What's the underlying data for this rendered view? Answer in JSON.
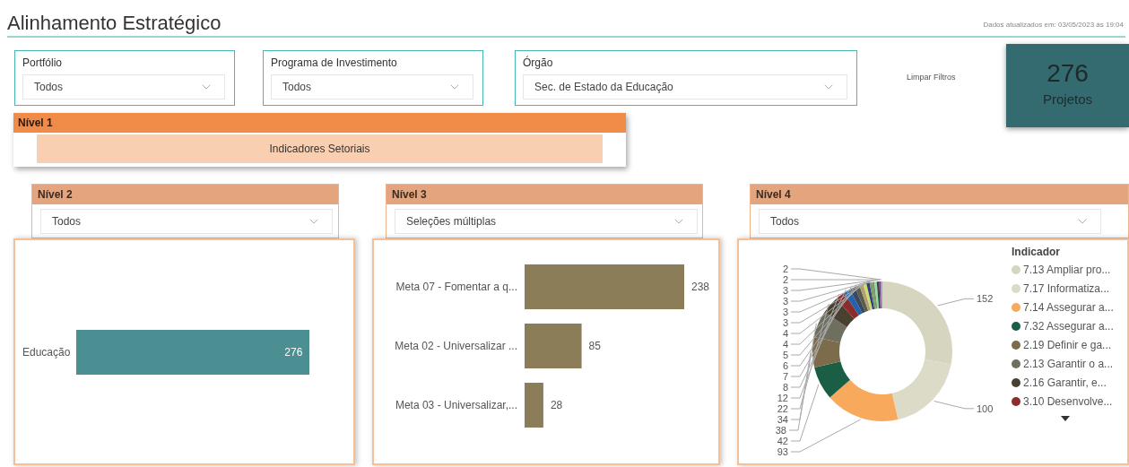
{
  "title": "Alinhamento Estratégico",
  "updated": "Dados atualizados em: 03/05/2023 às 19:04",
  "filters": [
    {
      "label": "Portfólio",
      "value": "Todos"
    },
    {
      "label": "Programa de Investimento",
      "value": "Todos"
    },
    {
      "label": "Órgão",
      "value": "Sec. de Estado da Educação"
    }
  ],
  "clear_filters": "Limpar Filtros",
  "kpi": {
    "value": "276",
    "label": "Projetos"
  },
  "level1": {
    "title": "Nível 1",
    "items": [
      {
        "label": "Indicadores Setoriais",
        "selected": true
      }
    ]
  },
  "levels": [
    {
      "title": "Nível 2",
      "value": "Todos",
      "bars": [
        {
          "label": "Educação",
          "value": "276",
          "level": 0.92
        }
      ]
    },
    {
      "title": "Nível 3",
      "value": "Seleções múltiplas",
      "chart_data": {
        "type": "bar",
        "orientation": "horizontal",
        "categories": [
          "Meta 07 - Fomentar a q...",
          "Meta 02 - Universalizar ...",
          "Meta 03 - Universalizar,..."
        ],
        "values": [
          238,
          85,
          28
        ],
        "data_labels": true,
        "color": "#8b7d58"
      }
    },
    {
      "title": "Nível 4",
      "value": "Todos",
      "chart_data": {
        "type": "donut",
        "values": [
          152,
          100,
          93,
          42,
          38,
          34,
          22,
          12,
          8,
          7,
          6,
          5,
          4,
          4,
          3,
          3,
          3,
          3,
          2,
          2
        ],
        "data_labels": true,
        "colors": [
          "#d6d5c0",
          "#dcdbc8",
          "#f8a95c",
          "#1b5e46",
          "#7d6c4c",
          "#6f6f60",
          "#4a4030",
          "#8c2c2c",
          "#2263b0",
          "#3a4a5c",
          "#5c5c4a",
          "#b3a070",
          "#c9e06b",
          "#3c3c7c",
          "#63a463",
          "#8c8c6c",
          "#8ae0a2",
          "#424242",
          "#6b3a8c",
          "#b493e2"
        ]
      },
      "legend": {
        "title": "Indicador",
        "items": [
          {
            "label": "7.13 Ampliar pro...",
            "color": "#d6d5c0"
          },
          {
            "label": "7.17 Informatiza...",
            "color": "#dcdbc8"
          },
          {
            "label": "7.14 Assegurar a...",
            "color": "#f8a95c"
          },
          {
            "label": "7.32 Assegurar a...",
            "color": "#1b5e46"
          },
          {
            "label": "2.19 Definir e ga...",
            "color": "#7d6c4c"
          },
          {
            "label": "2.13 Garantir o a...",
            "color": "#6f6f60"
          },
          {
            "label": "2.16 Garantir, e...",
            "color": "#4a4030"
          },
          {
            "label": "3.10 Desenvolve...",
            "color": "#8c2c2c"
          }
        ]
      }
    }
  ]
}
